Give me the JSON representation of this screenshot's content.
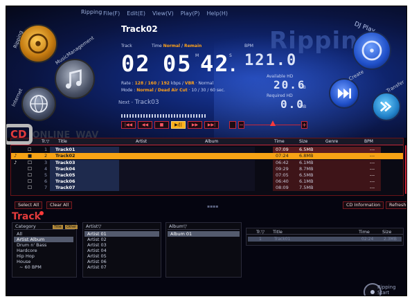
{
  "app": {
    "title": "Ripping",
    "menu": [
      "File(F)",
      "Edit(E)",
      "View(V)",
      "Play(P)",
      "Help(H)"
    ],
    "section_watermark": "Ripping"
  },
  "nav": {
    "ripping": "Ripping",
    "music_management": "MusicManagement",
    "internet": "Internet",
    "dj_play": "DJ Play",
    "create": "Create",
    "transfer": "Transfer"
  },
  "now_playing": {
    "track_name": "Track02",
    "track_label": "Track",
    "track_number": "02",
    "time_label": "Time",
    "time_mode_normal": "Normal",
    "time_mode_remain": "Remain",
    "time_minutes": "05",
    "time_seconds": "42",
    "time_frac": ".",
    "time_m_unit": "M",
    "time_s_unit": "S",
    "bpm_label": "BPM",
    "bpm_value": "121.0",
    "rate_label": "Rate :",
    "rate_values": "128 / 160 / 192",
    "rate_unit": "kbps /",
    "rate_vbr": "VBR",
    "rate_normal": "· Normal",
    "mode_label": "Mode :",
    "mode_normal": "Normal",
    "mode_dead_air": "/ Dead Air Cut",
    "mode_values": "· 10 / 30 / 60 sec.",
    "available_hd_label": "Available HD",
    "available_hd_value": "20.6",
    "available_hd_unit": "GB",
    "required_hd_label": "Required HD",
    "required_hd_value": "0.0",
    "required_hd_unit": "MB",
    "next_label": "Next -",
    "next_track": "Track03"
  },
  "transport": {
    "prev_label": "|◀◀",
    "rew_label": "◀◀",
    "stop_label": "■",
    "playpause_label": "▶/||",
    "ff_label": "▶▶",
    "next_label": "▶▶|",
    "vol_minus": "−",
    "vol_plus": "+"
  },
  "tabs": {
    "cd": "CD",
    "online": "ONLINE",
    "wav": "WAV"
  },
  "table": {
    "headers": {
      "tr": "Tr.▽",
      "title": "Title",
      "artist": "Artist",
      "album": "Album",
      "time": "Time",
      "size": "Size",
      "genre": "Genre",
      "bpm": "BPM"
    },
    "rows": [
      {
        "num": "1",
        "title": "Track01",
        "time": "07:09",
        "size": "6.5MB",
        "bpm": "---"
      },
      {
        "num": "2",
        "title": "Track02",
        "time": "07:24",
        "size": "6.8MB",
        "bpm": "---"
      },
      {
        "num": "3",
        "title": "Track03",
        "time": "06:42",
        "size": "6.1MB",
        "bpm": "---"
      },
      {
        "num": "4",
        "title": "Track04",
        "time": "09:29",
        "size": "8.7MB",
        "bpm": "---"
      },
      {
        "num": "5",
        "title": "Track05",
        "time": "07:05",
        "size": "6.5MB",
        "bpm": "---"
      },
      {
        "num": "6",
        "title": "Track06",
        "time": "06:40",
        "size": "6.1MB",
        "bpm": "---"
      },
      {
        "num": "7",
        "title": "Track07",
        "time": "08:09",
        "size": "7.5MB",
        "bpm": "---"
      }
    ]
  },
  "actions": {
    "select_all": "Select All",
    "clear_all": "Clear All",
    "cd_information": "CD Information",
    "refresh": "Refresh"
  },
  "library": {
    "heading": "Track",
    "category_header": "Category",
    "tag_title": "Title",
    "tag_other": "Other",
    "categories": [
      "All",
      "Artist Album",
      "Drum n' Bass",
      "Hardcore",
      "Hip Hop",
      "House",
      "~ 60 BPM"
    ],
    "artist_header": "Artist▽",
    "artists": [
      "Artist 01",
      "Artist 02",
      "Artist 03",
      "Artist 04",
      "Artist 05",
      "Artist 06",
      "Artist 07"
    ],
    "album_header": "Album▽",
    "albums": [
      "Album 01"
    ],
    "result_headers": {
      "tr": "Tr.▽",
      "title": "Title",
      "time": "Time",
      "size": "Size"
    },
    "result_row": {
      "num": "1",
      "title": "Track01",
      "time": "02:24",
      "size": "2.3MB"
    }
  },
  "footer": {
    "rip_start": "Ripping Start"
  }
}
